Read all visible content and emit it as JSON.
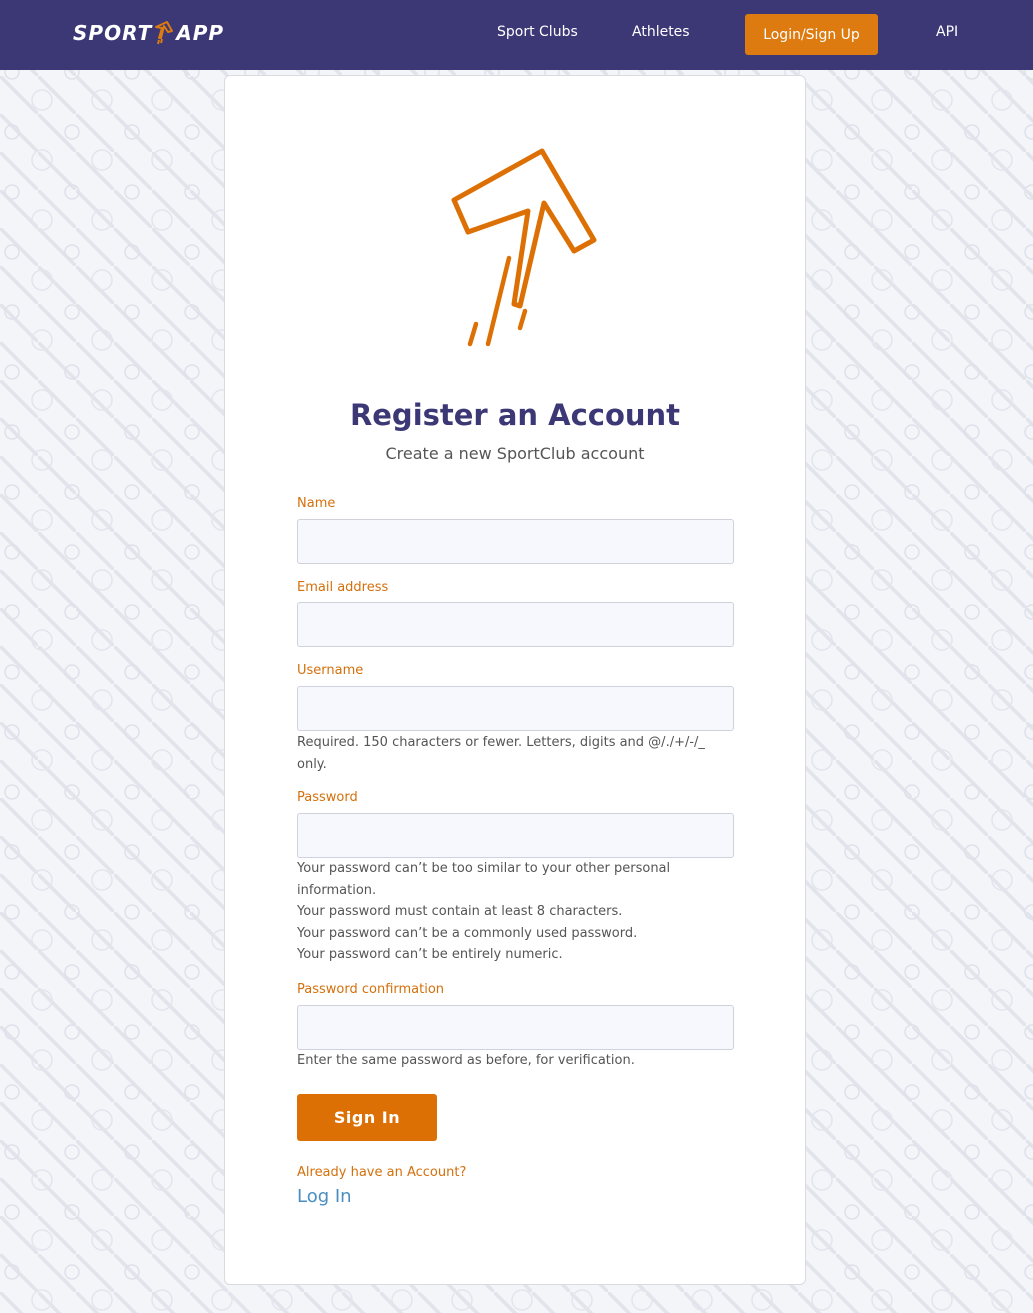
{
  "navbar": {
    "brand_left": "SPORT",
    "brand_right": "APP",
    "links": {
      "sport_clubs": "Sport Clubs",
      "athletes": "Athletes",
      "login_signup": "Login/Sign Up",
      "api": "API"
    }
  },
  "colors": {
    "navbar_bg": "#3c3876",
    "accent_orange": "#dd7a10",
    "title_navy": "#3c3876",
    "link_blue": "#4a8fc0"
  },
  "form": {
    "logo_icon": "rising-arrow-icon",
    "title": "Register an Account",
    "subtitle": "Create a new SportClub account",
    "fields": {
      "name": {
        "label": "Name",
        "value": ""
      },
      "email": {
        "label": "Email address",
        "value": ""
      },
      "username": {
        "label": "Username",
        "value": "",
        "help": "Required. 150 characters or fewer. Letters, digits and @/./+/-/_ only."
      },
      "password": {
        "label": "Password",
        "value": "",
        "help": [
          "Your password can’t be too similar to your other personal information.",
          "Your password must contain at least 8 characters.",
          "Your password can’t be a commonly used password.",
          "Your password can’t be entirely numeric."
        ]
      },
      "password_confirmation": {
        "label": "Password confirmation",
        "value": "",
        "help": "Enter the same password as before, for verification."
      }
    },
    "submit_label": "Sign  In",
    "already_text": "Already have an Account?",
    "login_link": "Log In"
  }
}
